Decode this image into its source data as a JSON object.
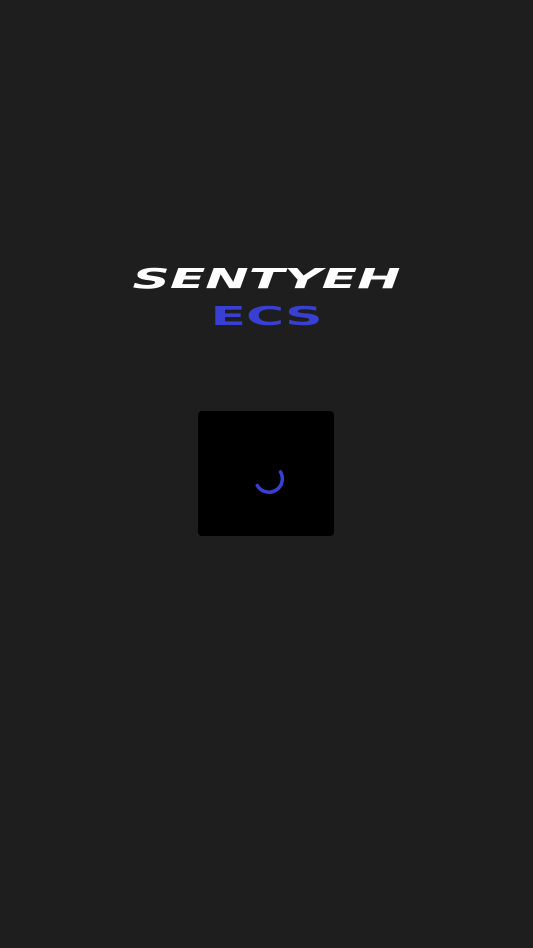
{
  "splash": {
    "brand_name": "SENTYEH",
    "product_name": "ECS",
    "colors": {
      "background": "#1e1e1e",
      "brand": "#ffffff",
      "accent": "#3a3fd4",
      "loader_background": "#000000"
    },
    "loader": {
      "icon": "loading-spinner-icon"
    }
  }
}
